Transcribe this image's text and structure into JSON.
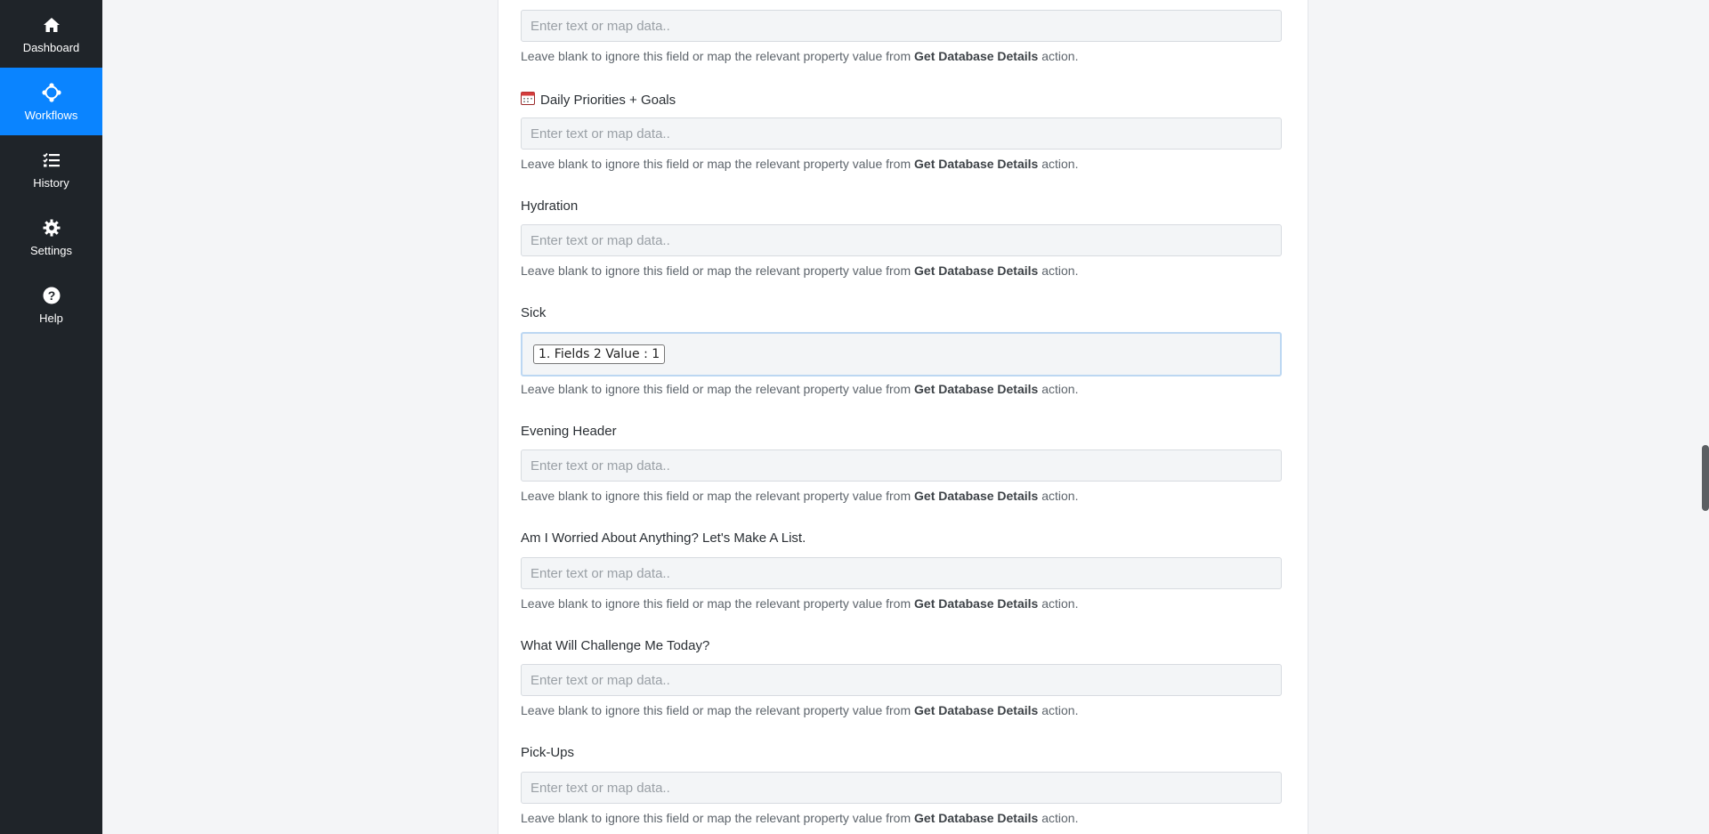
{
  "sidebar": {
    "items": [
      {
        "label": "Dashboard",
        "icon": "home-icon",
        "active": false
      },
      {
        "label": "Workflows",
        "icon": "workflow-icon",
        "active": true
      },
      {
        "label": "History",
        "icon": "history-list-icon",
        "active": false
      },
      {
        "label": "Settings",
        "icon": "gear-icon",
        "active": false
      },
      {
        "label": "Help",
        "icon": "help-icon",
        "active": false
      }
    ]
  },
  "form": {
    "placeholder": "Enter text or map data..",
    "help_prefix": "Leave blank to ignore this field or map the relevant property value from ",
    "help_action": "Get Database Details",
    "help_suffix": " action.",
    "fields": [
      {
        "label": ""
      },
      {
        "label": "Daily Priorities + Goals",
        "icon": "calendar-icon"
      },
      {
        "label": "Hydration"
      },
      {
        "label": "Sick",
        "chip": "1. Fields 2 Value : 1"
      },
      {
        "label": "Evening Header"
      },
      {
        "label": "Am I Worried About Anything? Let's Make A List."
      },
      {
        "label": "What Will Challenge Me Today?"
      },
      {
        "label": "Pick-Ups"
      }
    ]
  },
  "colors": {
    "sidebar_bg": "#1f2429",
    "active_nav": "#0a84ff"
  }
}
